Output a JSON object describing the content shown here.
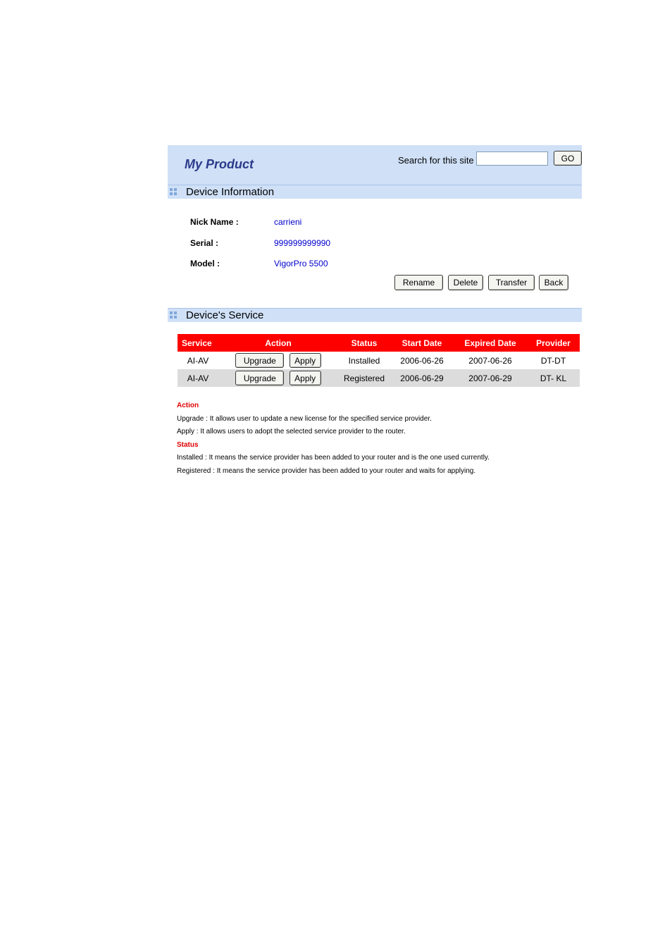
{
  "header": {
    "title": "My Product",
    "search_label": "Search for this site",
    "search_value": "",
    "go_label": "GO"
  },
  "device_info": {
    "section_title": "Device Information",
    "fields": [
      {
        "label": "Nick Name :",
        "value": "carrieni"
      },
      {
        "label": "Serial :",
        "value": "999999999990"
      },
      {
        "label": "Model :",
        "value": "VigorPro 5500"
      }
    ],
    "buttons": {
      "rename": "Rename",
      "delete": "Delete",
      "transfer": "Transfer",
      "back": "Back"
    }
  },
  "services": {
    "section_title": "Device's Service",
    "columns": [
      "Service",
      "Action",
      "Status",
      "Start Date",
      "Expired Date",
      "Provider"
    ],
    "rows": [
      {
        "service": "AI-AV",
        "upgrade": "Upgrade",
        "apply": "Apply",
        "status": "Installed",
        "start": "2006-06-26",
        "expired": "2007-06-26",
        "provider": "DT-DT"
      },
      {
        "service": "AI-AV",
        "upgrade": "Upgrade",
        "apply": "Apply",
        "status": "Registered",
        "start": "2006-06-29",
        "expired": "2007-06-29",
        "provider": "DT- KL"
      }
    ]
  },
  "notes": {
    "action_head": "Action",
    "upgrade_note": "Upgrade : It allows user to update a new license for the specified service provider.",
    "apply_note": "Apply : It allows users to adopt the selected service provider to the router.",
    "status_head": "Status",
    "installed_note": "Installed : It means the service provider has been added to your router and is the one used currently.",
    "registered_note": "Registered : It means the service provider has been added to your router and waits for applying."
  }
}
